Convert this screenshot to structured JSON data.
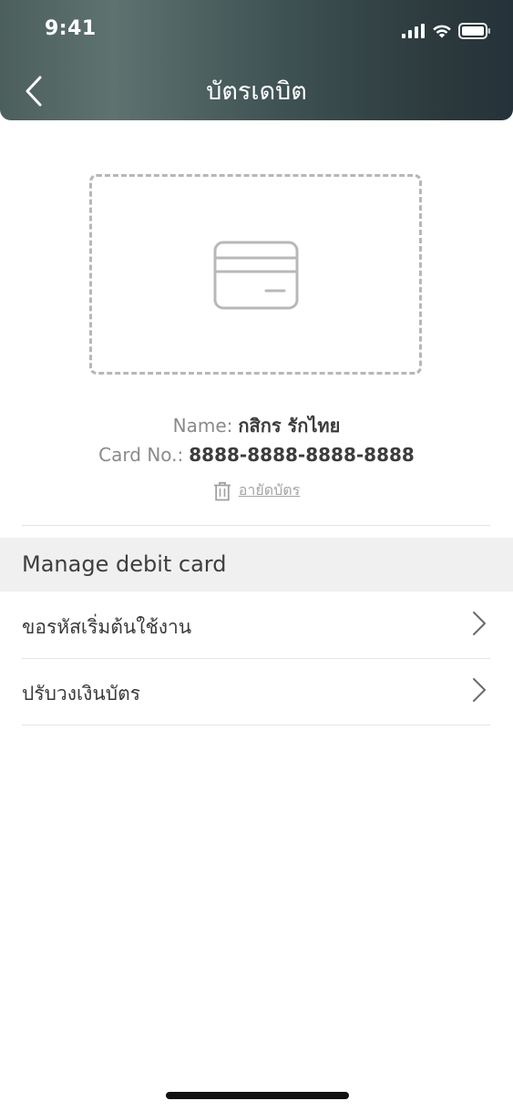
{
  "status_bar": {
    "time": "9:41"
  },
  "header": {
    "title": "บัตรเดบิต"
  },
  "card": {
    "name_label": "Name:",
    "name_value": "กสิกร รักไทย",
    "card_no_label": "Card No.:",
    "card_no_value": "8888-8888-8888-8888",
    "cancel_label": "อายัดบัตร"
  },
  "manage": {
    "section_title": "Manage debit card",
    "items": [
      {
        "label": "ขอรหัสเริ่มต้นใช้งาน"
      },
      {
        "label": "ปรับวงเงินบัตร"
      }
    ]
  },
  "colors": {
    "header_gradient_start": "#4c5f5d",
    "header_gradient_end": "#25323a",
    "section_bg": "#f0f0f0"
  }
}
